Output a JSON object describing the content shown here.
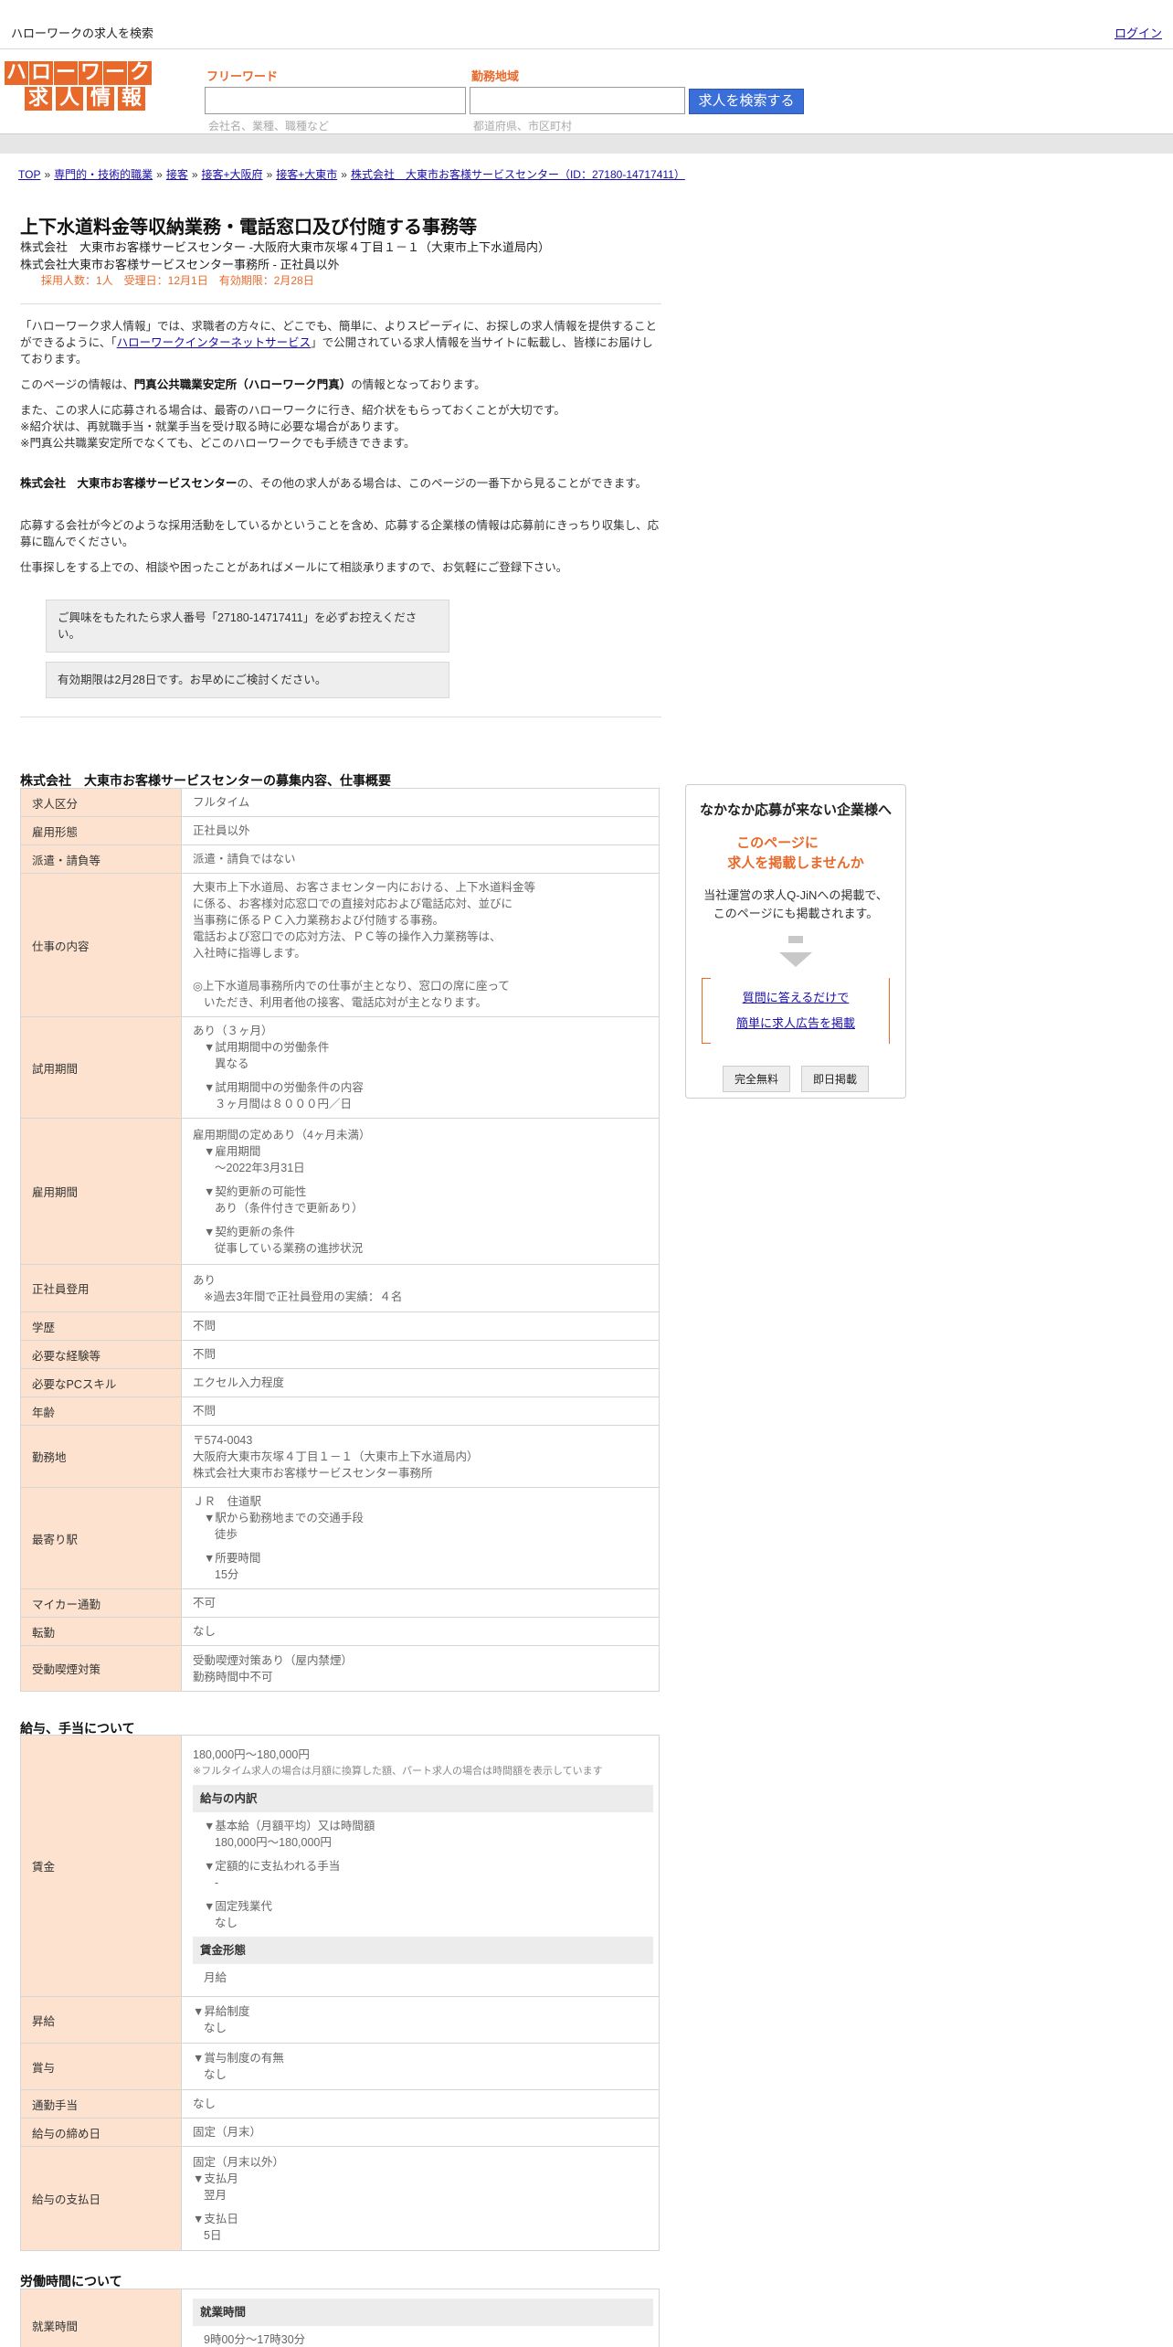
{
  "topbar": {
    "site_tag": "ハローワークの求人を検索",
    "login": "ログイン"
  },
  "logo": {
    "row1": [
      "ハ",
      "ロ",
      "ー",
      "ワ",
      "ー",
      "ク"
    ],
    "row2": [
      "求",
      "人",
      "情",
      "報"
    ]
  },
  "search": {
    "freeword_label": "フリーワード",
    "freeword_hint": "会社名、業種、職種など",
    "area_label": "勤務地域",
    "area_hint": "都道府県、市区町村",
    "button": "求人を検索する"
  },
  "breadcrumb": [
    "TOP",
    "専門的・技術的職業",
    "接客",
    "接客+大阪府",
    "接客+大東市",
    "株式会社　大東市お客様サービスセンター（ID：27180-14717411）"
  ],
  "job": {
    "title": "上下水道料金等収納業務・電話窓口及び付随する事務等",
    "company_line": "株式会社　大東市お客様サービスセンター -大阪府大東市灰塚４丁目１－１（大東市上下水道局内）",
    "office_line": "株式会社大東市お客様サービスセンター事務所 - 正社員以外",
    "meta": "採用人数：1人　受理日：12月1日　有効期限：2月28日"
  },
  "intro": {
    "p1_a": "「ハローワーク求人情報」では、求職者の方々に、どこでも、簡単に、よりスピーディに、お探しの求人情報を提供することができるように、「",
    "p1_link": "ハローワークインターネットサービス",
    "p1_b": "」で公開されている求人情報を当サイトに転載し、皆様にお届けしております。",
    "p2_a": "このページの情報は、",
    "p2_b": "門真公共職業安定所（ハローワーク門真）",
    "p2_c": "の情報となっております。",
    "p3_1": "また、この求人に応募される場合は、最寄のハローワークに行き、紹介状をもらっておくことが大切です。",
    "p3_2": "※紹介状は、再就職手当・就業手当を受け取る時に必要な場合があります。",
    "p3_3": "※門真公共職業安定所でなくても、どこのハローワークでも手続きできます。",
    "p4_a": "株式会社　大東市お客様サービスセンター",
    "p4_b": "の、その他の求人がある場合は、このページの一番下から見ることができます。",
    "p5": "応募する会社が今どのような採用活動をしているかということを含め、応募する企業様の情報は応募前にきっちり収集し、応募に臨んでください。",
    "p6": "仕事探しをする上での、相談や困ったことがあればメールにて相談承りますので、お気軽にご登録下さい。"
  },
  "notices": {
    "n1": "ご興味をもたれたら求人番号「27180-14717411」を必ずお控えください。",
    "n2": "有効期限は2月28日です。お早めにご検討ください。"
  },
  "sections": {
    "overview": "株式会社　大東市お客様サービスセンターの募集内容、仕事概要",
    "pay": "給与、手当について",
    "hours": "労働時間について"
  },
  "overview": {
    "kubun": {
      "label": "求人区分",
      "value": "フルタイム"
    },
    "keitai": {
      "label": "雇用形態",
      "value": "正社員以外"
    },
    "haken": {
      "label": "派遣・請負等",
      "value": "派遣・請負ではない"
    },
    "naiyou": {
      "label": "仕事の内容",
      "l1": "大東市上下水道局、お客さまセンター内における、上下水道料金等",
      "l2": "に係る、お客様対応窓口での直接対応および電話応対、並びに",
      "l3": "当事務に係るＰＣ入力業務および付随する事務。",
      "l4": "電話および窓口での応対方法、ＰＣ等の操作入力業務等は、",
      "l5": "入社時に指導します。",
      "l6": "◎上下水道局事務所内での仕事が主となり、窓口の席に座って",
      "l7": "いただき、利用者他の接客、電話応対が主となります。"
    },
    "shiyou": {
      "label": "試用期間",
      "l1": "あり（３ヶ月）",
      "l2": "▼試用期間中の労働条件",
      "l3": "異なる",
      "l4": "▼試用期間中の労働条件の内容",
      "l5": "３ヶ月間は８０００円／日"
    },
    "koyou": {
      "label": "雇用期間",
      "l1": "雇用期間の定めあり（4ヶ月未満）",
      "l2": "▼雇用期間",
      "l3": "〜2022年3月31日",
      "l4": "▼契約更新の可能性",
      "l5": "あり（条件付きで更新あり）",
      "l6": "▼契約更新の条件",
      "l7": "従事している業務の進捗状況"
    },
    "seishain": {
      "label": "正社員登用",
      "l1": "あり",
      "l2": "※過去3年間で正社員登用の実績：４名"
    },
    "gakureki": {
      "label": "学歴",
      "value": "不問"
    },
    "keiken": {
      "label": "必要な経験等",
      "value": "不問"
    },
    "pc": {
      "label": "必要なPCスキル",
      "value": "エクセル入力程度"
    },
    "nenrei": {
      "label": "年齢",
      "value": "不問"
    },
    "kinmuchi": {
      "label": "勤務地",
      "l1": "〒574-0043",
      "l2": "大阪府大東市灰塚４丁目１－１（大東市上下水道局内）",
      "l3": "株式会社大東市お客様サービスセンター事務所"
    },
    "eki": {
      "label": "最寄り駅",
      "l1": "ＪＲ　住道駅",
      "l2": "▼駅から勤務地までの交通手段",
      "l3": "徒歩",
      "l4": "▼所要時間",
      "l5": "15分"
    },
    "mycar": {
      "label": "マイカー通勤",
      "value": "不可"
    },
    "tenkin": {
      "label": "転勤",
      "value": "なし"
    },
    "kitsuen": {
      "label": "受動喫煙対策",
      "l1": "受動喫煙対策あり（屋内禁煙）",
      "l2": "勤務時間中不可"
    }
  },
  "pay": {
    "chingin": {
      "label": "賃金",
      "l1": "180,000円〜180,000円",
      "note": "※フルタイム求人の場合は月額に換算した額、パート求人の場合は時間額を表示しています",
      "sub1": "給与の内訳",
      "k1": "▼基本給（月額平均）又は時間額",
      "v1": "180,000円〜180,000円",
      "k2": "▼定額的に支払われる手当",
      "v2": "-",
      "k3": "▼固定残業代",
      "v3": "なし",
      "sub2": "賃金形態",
      "v4": "月給"
    },
    "shoukyuu": {
      "label": "昇給",
      "l1": "▼昇給制度",
      "l2": "なし"
    },
    "shouyo": {
      "label": "賞与",
      "l1": "▼賞与制度の有無",
      "l2": "なし"
    },
    "tsukin": {
      "label": "通勤手当",
      "value": "なし"
    },
    "shimebi": {
      "label": "給与の締め日",
      "value": "固定（月末）"
    },
    "shiharaibi": {
      "label": "給与の支払日",
      "l1": "固定（月末以外）",
      "l2": "▼支払月",
      "l3": "翌月",
      "l4": "▼支払日",
      "l5": "5日"
    }
  },
  "hours": {
    "shugyo": {
      "label": "就業時間",
      "sub": "就業時間",
      "l1": "9時00分〜17時30分"
    }
  },
  "ad": {
    "title": "なかなか応募が来ない企業様へ",
    "catch1": "このページに",
    "catch2": "求人を掲載しませんか",
    "desc1": "当社運営の求人Q-JiNへの掲載で、",
    "desc2": "このページにも掲載されます。",
    "link1": "質問に答えるだけで",
    "link2": "簡単に求人広告を掲載",
    "badge1": "完全無料",
    "badge2": "即日掲載"
  }
}
